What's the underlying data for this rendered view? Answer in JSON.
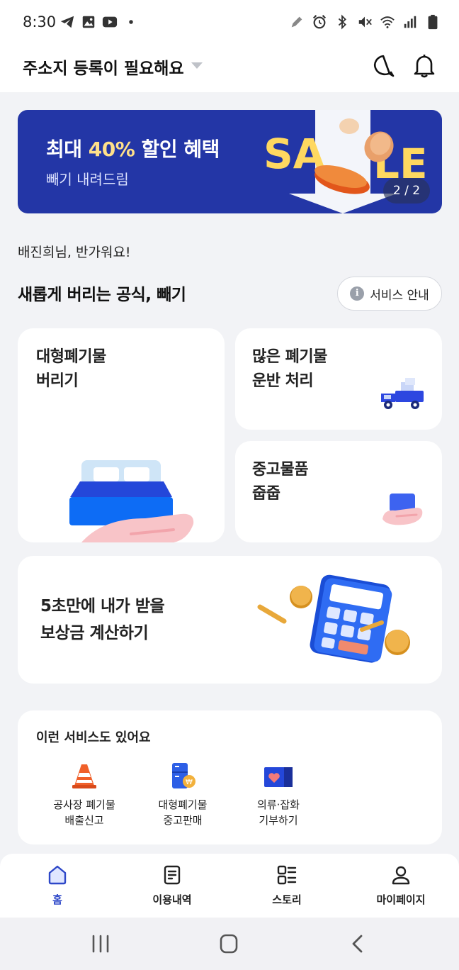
{
  "status_bar": {
    "time": "8:30",
    "left_icons": [
      "telegram-icon",
      "gallery-icon",
      "youtube-icon",
      "dot-icon"
    ],
    "right_icons": [
      "pen-icon",
      "alarm-icon",
      "bluetooth-icon",
      "mute-icon",
      "wifi-icon",
      "signal-icon",
      "battery-icon"
    ]
  },
  "header": {
    "address": "주소지 등록이 필요해요",
    "icons": [
      "chat-icon",
      "bell-icon"
    ]
  },
  "banner": {
    "title_prefix": "최대 ",
    "title_highlight": "40%",
    "title_suffix": " 할인 혜택",
    "subtitle": "빼기 내려드림",
    "art_text_1": "SA",
    "art_text_2": "LE",
    "page_indicator": "2 / 2",
    "colors": {
      "background": "#2336a6",
      "highlight": "#ffe08a"
    }
  },
  "greeting": "배진희님, 반가워요!",
  "section": {
    "title": "새롭게 버리는 공식, 빼기",
    "guide_button": "서비스 안내"
  },
  "cards": {
    "large_waste": {
      "line1": "대형폐기물",
      "line2": "버리기"
    },
    "bulk_transport": {
      "line1": "많은 폐기물",
      "line2": "운반 처리"
    },
    "used_goods": {
      "line1": "중고물품",
      "line2": "줍줍"
    },
    "calculator": {
      "line1": "5초만에 내가 받을",
      "line2": "보상금 계산하기"
    }
  },
  "more_services": {
    "title": "이런 서비스도 있어요",
    "items": [
      {
        "label": "공사장 폐기물\n배출신고",
        "icon": "traffic-cone-icon"
      },
      {
        "label": "대형폐기물\n중고판매",
        "icon": "fridge-coin-icon"
      },
      {
        "label": "의류·잡화\n기부하기",
        "icon": "donation-box-icon"
      }
    ]
  },
  "bottom_nav": {
    "items": [
      {
        "label": "홈",
        "icon": "home-icon",
        "active": true
      },
      {
        "label": "이용내역",
        "icon": "history-icon",
        "active": false
      },
      {
        "label": "스토리",
        "icon": "story-icon",
        "active": false
      },
      {
        "label": "마이페이지",
        "icon": "person-icon",
        "active": false
      }
    ],
    "active_color": "#2d47c8"
  },
  "system_nav": [
    "recents-button",
    "home-button",
    "back-button"
  ]
}
